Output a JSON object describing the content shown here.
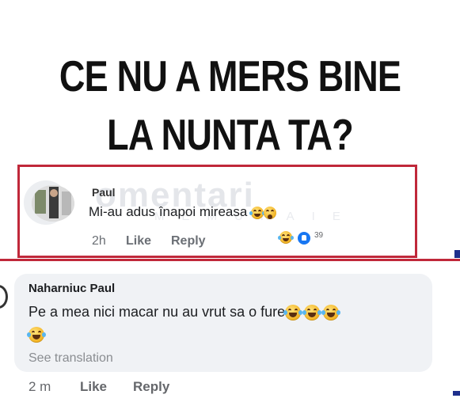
{
  "headline": {
    "line1": "CE NU A MERS BINE",
    "line2": "LA NUNTA TA?"
  },
  "watermark": {
    "text": "omentari",
    "subtext": "MEMURAIE"
  },
  "comment1": {
    "author": "Paul",
    "text": "Mi-au adus înapoi mireasa",
    "time": "2h",
    "like_label": "Like",
    "reply_label": "Reply",
    "reaction_count": "39",
    "reactions": [
      "laughing-crying-emoji",
      "like-reaction",
      "wow-emoji"
    ]
  },
  "comment2": {
    "author": "Naharniuc Paul",
    "text": "Pe a mea nici macar nu au vrut sa o fure",
    "see_translation": "See translation",
    "time": "2 m",
    "like_label": "Like",
    "reply_label": "Reply"
  },
  "colors": {
    "frame": "#c0283a",
    "bubble": "#f0f2f5",
    "meta": "#65676b"
  }
}
